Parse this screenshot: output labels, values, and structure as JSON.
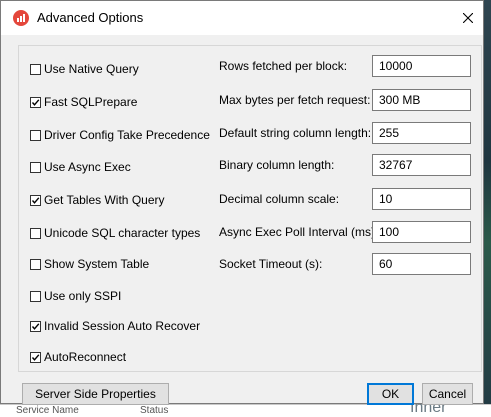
{
  "window": {
    "title": "Advanced Options",
    "accent_icon_color": "#e4473c"
  },
  "checkboxes": [
    {
      "label": "Use Native Query",
      "checked": false
    },
    {
      "label": "Fast SQLPrepare",
      "checked": true
    },
    {
      "label": "Driver Config Take Precedence",
      "checked": false
    },
    {
      "label": "Use Async Exec",
      "checked": false
    },
    {
      "label": "Get Tables With Query",
      "checked": true
    },
    {
      "label": "Unicode SQL character types",
      "checked": false
    },
    {
      "label": "Show System Table",
      "checked": false
    },
    {
      "label": "Use only SSPI",
      "checked": false
    },
    {
      "label": "Invalid Session Auto Recover",
      "checked": true
    },
    {
      "label": "AutoReconnect",
      "checked": true
    }
  ],
  "fields": [
    {
      "label": "Rows fetched per block:",
      "value": "10000"
    },
    {
      "label": "Max bytes per fetch request:",
      "value": "300 MB"
    },
    {
      "label": "Default string column length:",
      "value": "255"
    },
    {
      "label": "Binary column length:",
      "value": "32767"
    },
    {
      "label": "Decimal column scale:",
      "value": "10"
    },
    {
      "label": "Async Exec Poll Interval (ms):",
      "value": "100"
    },
    {
      "label": "Socket Timeout (s):",
      "value": "60"
    }
  ],
  "buttons": {
    "server_side": "Server Side Properties",
    "ok": "OK",
    "cancel": "Cancel"
  },
  "background": {
    "col1": "Service Name",
    "col2": "Status",
    "col3": "Inner"
  }
}
